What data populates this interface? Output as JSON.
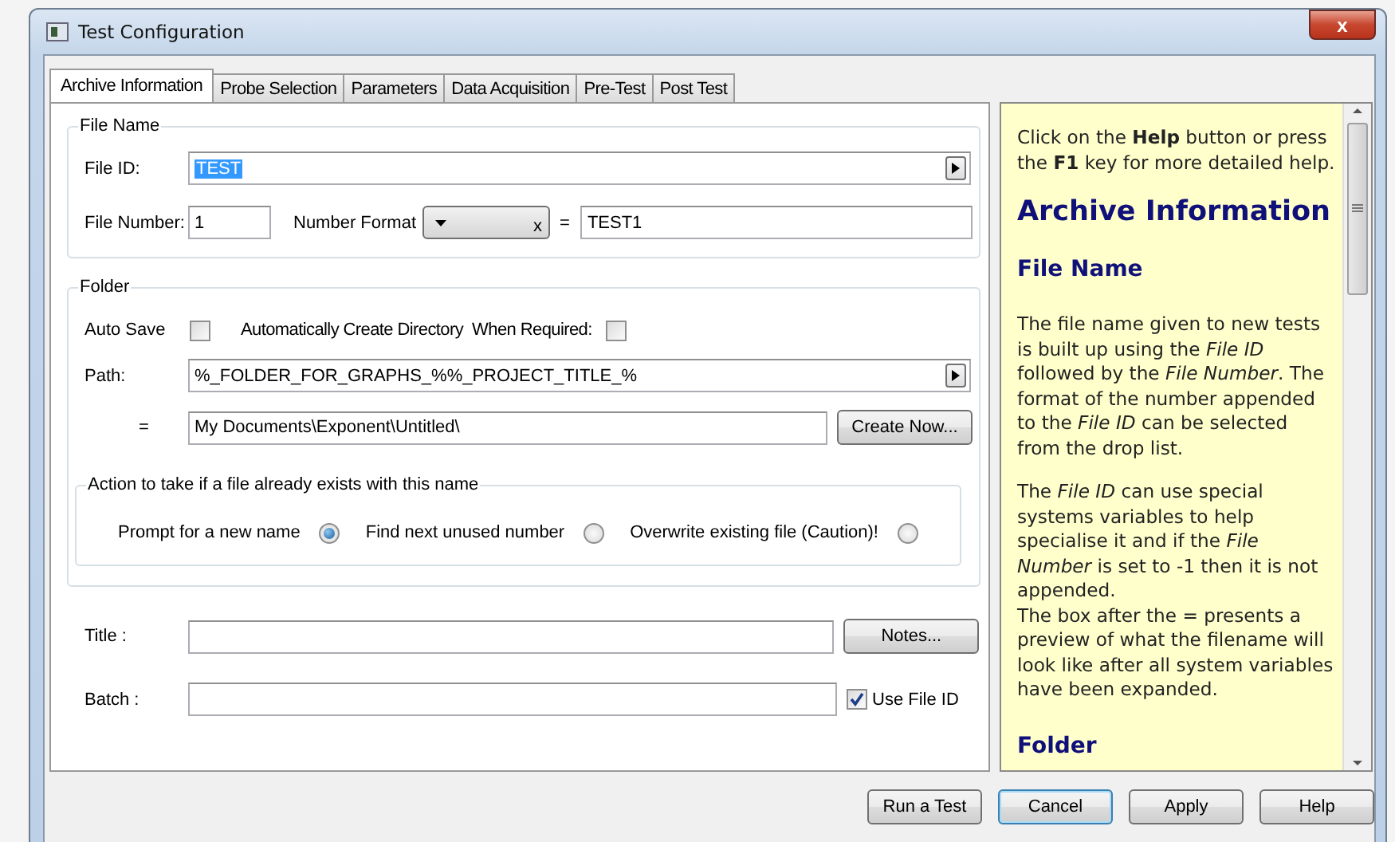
{
  "window": {
    "title": "Test Configuration",
    "close": "x"
  },
  "tabs": [
    {
      "label": "Archive Information",
      "selected": true
    },
    {
      "label": "Probe Selection",
      "selected": false
    },
    {
      "label": "Parameters",
      "selected": false
    },
    {
      "label": "Data Acquisition",
      "selected": false
    },
    {
      "label": "Pre-Test",
      "selected": false
    },
    {
      "label": "Post Test",
      "selected": false
    }
  ],
  "file_name": {
    "legend": "File Name",
    "file_id_label": "File ID:",
    "file_id": "TEST",
    "file_id_highlighted": true,
    "file_number_label": "File Number:",
    "file_number": "1",
    "number_format_label": "Number Format",
    "number_format_clear": "x",
    "equals": "=",
    "preview": "TEST1"
  },
  "folder": {
    "legend": "Folder",
    "auto_save": {
      "label": "Auto Save",
      "checked": false
    },
    "auto_create": {
      "label": "Automatically Create Directory  When Required:",
      "checked": false
    },
    "path_label": "Path:",
    "path": "%_FOLDER_FOR_GRAPHS_%%_PROJECT_TITLE_%",
    "equals": "=",
    "resolved": "My Documents\\Exponent\\Untitled\\",
    "create_button": "Create Now...",
    "action": {
      "legend": "Action to take if a file already exists with this name",
      "options": [
        {
          "label": "Prompt for a new name",
          "selected": true
        },
        {
          "label": "Find next unused number",
          "selected": false
        },
        {
          "label": "Overwrite existing file (Caution)!",
          "selected": false
        }
      ]
    }
  },
  "title_label": "Title :",
  "notes_button": "Notes...",
  "batch_label": "Batch :",
  "use_file_id": {
    "label": "Use File ID",
    "checked": true
  },
  "help": [
    {
      "kind": "text",
      "text": "Click on the **Help** button or press the **F1** key for more detailed help."
    },
    {
      "kind": "heading",
      "text": "Archive Information"
    },
    {
      "kind": "subheading",
      "text": "File Name"
    },
    {
      "kind": "text",
      "text": "The file name given to new tests is built up using the *File ID* followed by the *File Number*. The format of the number appended to the *File ID* can be selected from the drop list."
    },
    {
      "kind": "line",
      "text": "The *File ID* can use special systems variables to help specialise it and if the *File Number* is set to -1 then it is not appended."
    },
    {
      "kind": "line",
      "text": "The box after the = presents a preview of what the filename will look like after all system variables have been expanded."
    },
    {
      "kind": "subheading",
      "text": "Folder"
    }
  ],
  "buttons": [
    {
      "label": "Run a Test",
      "focused": false
    },
    {
      "label": "Cancel",
      "focused": true
    },
    {
      "label": "Apply",
      "focused": false
    },
    {
      "label": "Help",
      "focused": false
    }
  ]
}
